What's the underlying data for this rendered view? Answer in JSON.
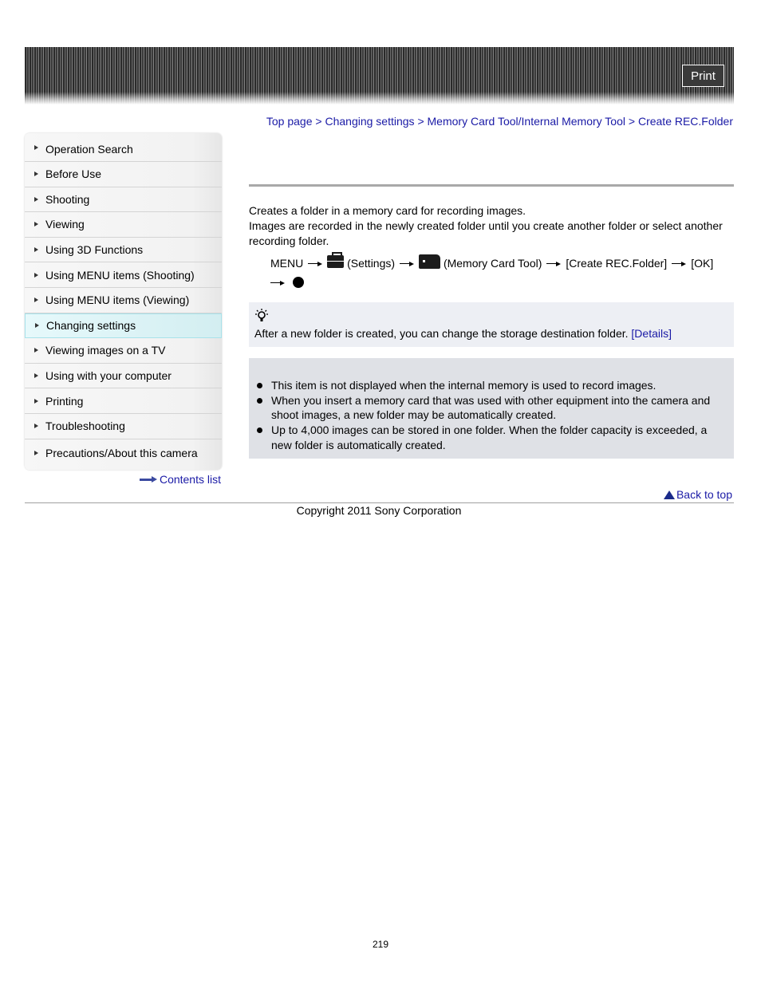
{
  "header": {
    "print_label": "Print"
  },
  "breadcrumb": [
    {
      "label": "Top page"
    },
    {
      "label": "Changing settings"
    },
    {
      "label": "Memory Card Tool/Internal Memory Tool"
    },
    {
      "label": "Create REC.Folder"
    }
  ],
  "breadcrumb_separator": ">",
  "sidebar": {
    "items": [
      {
        "label": "Operation Search"
      },
      {
        "label": "Before Use"
      },
      {
        "label": "Shooting"
      },
      {
        "label": "Viewing"
      },
      {
        "label": "Using 3D Functions"
      },
      {
        "label": "Using MENU items (Shooting)"
      },
      {
        "label": "Using MENU items (Viewing)"
      },
      {
        "label": "Changing settings",
        "active": true
      },
      {
        "label": "Viewing images on a TV"
      },
      {
        "label": "Using with your computer"
      },
      {
        "label": "Printing"
      },
      {
        "label": "Troubleshooting"
      },
      {
        "label": "Precautions/About this camera"
      }
    ],
    "contents_link": "Contents list"
  },
  "main": {
    "intro_line1": "Creates a folder in a memory card for recording images.",
    "intro_line2": "Images are recorded in the newly created folder until you create another folder or select another recording folder.",
    "procedure": {
      "menu": "MENU",
      "settings": "(Settings)",
      "memory_card_tool": "(Memory Card Tool)",
      "create_folder": "[Create REC.Folder]",
      "ok": "[OK]"
    },
    "hint": {
      "text": "After a new folder is created, you can change the storage destination folder.",
      "link": "[Details]"
    },
    "notes": [
      "This item is not displayed when the internal memory is used to record images.",
      "When you insert a memory card that was used with other equipment into the camera and shoot images, a new folder may be automatically created.",
      "Up to 4,000 images can be stored in one folder. When the folder capacity is exceeded, a new folder is automatically created."
    ],
    "back_to_top": "Back to top"
  },
  "footer": {
    "copyright": "Copyright 2011 Sony Corporation",
    "page_number": "219"
  }
}
